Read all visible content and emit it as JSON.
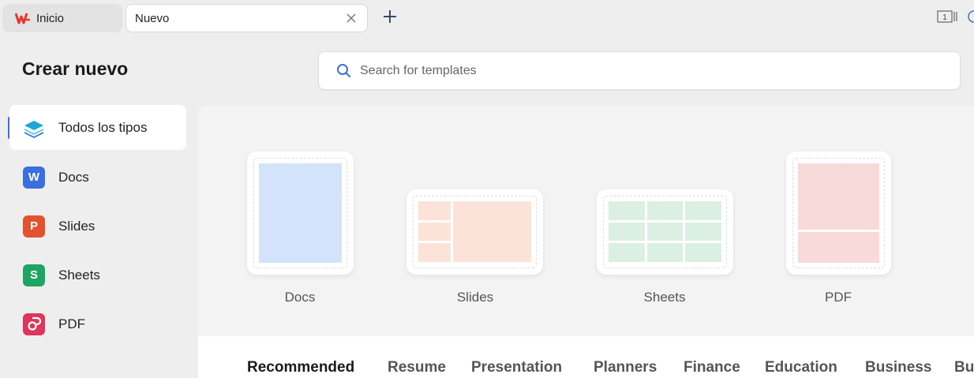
{
  "tabs": {
    "home_label": "Inicio",
    "new_label": "Nuevo"
  },
  "window": {
    "page_indicator": "1"
  },
  "header": {
    "title": "Crear nuevo",
    "search_placeholder": "Search for templates"
  },
  "sidebar": {
    "items": [
      {
        "label": "Todos los tipos",
        "icon": "layers-icon",
        "active": true
      },
      {
        "label": "Docs",
        "icon": "W",
        "color": "#3b6fe0"
      },
      {
        "label": "Slides",
        "icon": "P",
        "color": "#e2522f"
      },
      {
        "label": "Sheets",
        "icon": "S",
        "color": "#1fa463"
      },
      {
        "label": "PDF",
        "icon": "pdf-icon",
        "color": "#e0355a"
      }
    ]
  },
  "cards": [
    {
      "label": "Docs",
      "color": "#d3e3fb"
    },
    {
      "label": "Slides",
      "color": "#fbe3da"
    },
    {
      "label": "Sheets",
      "color": "#dcefe3"
    },
    {
      "label": "PDF",
      "color": "#f8dada"
    }
  ],
  "categories": [
    "Recommended",
    "Resume",
    "Presentation",
    "Planners",
    "Finance",
    "Education",
    "Business",
    "Bu"
  ]
}
